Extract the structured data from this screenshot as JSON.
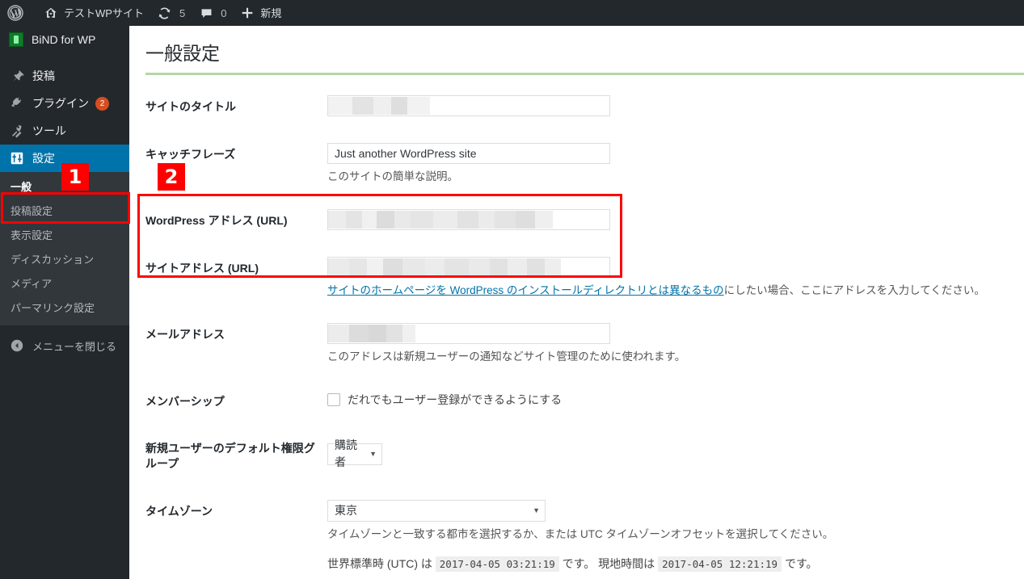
{
  "adminbar": {
    "logo_icon": "wordpress-logo-icon",
    "site_name": "テストWPサイト",
    "site_icon": "home-icon",
    "updates_icon": "updates-icon",
    "updates_count": "5",
    "comments_icon": "comment-bubble-icon",
    "comments_count": "0",
    "new_icon": "plus-icon",
    "new_label": "新規"
  },
  "sidebar": {
    "bind": {
      "label": "BiND for WP",
      "icon": "bind-app-icon"
    },
    "items": [
      {
        "label": "投稿",
        "icon": "pin-icon",
        "badge": ""
      },
      {
        "label": "プラグイン",
        "icon": "plug-icon",
        "badge": "2"
      },
      {
        "label": "ツール",
        "icon": "wrench-icon",
        "badge": ""
      },
      {
        "label": "設定",
        "icon": "sliders-icon",
        "badge": "",
        "current": true
      }
    ],
    "submenu": [
      {
        "label": "一般",
        "current": true
      },
      {
        "label": "投稿設定",
        "current": false
      },
      {
        "label": "表示設定",
        "current": false
      },
      {
        "label": "ディスカッション",
        "current": false
      },
      {
        "label": "メディア",
        "current": false
      },
      {
        "label": "パーマリンク設定",
        "current": false
      }
    ],
    "collapse": {
      "label": "メニューを閉じる",
      "icon": "collapse-arrow-icon"
    }
  },
  "main": {
    "page_title": "一般設定",
    "fields": {
      "site_title": {
        "label": "サイトのタイトル",
        "value": "",
        "redacted": true
      },
      "tagline": {
        "label": "キャッチフレーズ",
        "value": "Just another WordPress site",
        "desc": "このサイトの簡単な説明。"
      },
      "wp_address": {
        "label": "WordPress アドレス (URL)",
        "value": "",
        "redacted": true
      },
      "site_address": {
        "label": "サイトアドレス (URL)",
        "value": "",
        "redacted": true,
        "desc_link": "サイトのホームページを WordPress のインストールディレクトリとは異なるもの",
        "desc_tail": "にしたい場合、ここにアドレスを入力してください。"
      },
      "email": {
        "label": "メールアドレス",
        "value": "",
        "redacted": true,
        "desc": "このアドレスは新規ユーザーの通知などサイト管理のために使われます。"
      },
      "membership": {
        "label": "メンバーシップ",
        "checkbox_label": "だれでもユーザー登録ができるようにする",
        "checked": false
      },
      "default_role": {
        "label": "新規ユーザーのデフォルト権限グループ",
        "value": "購読者"
      },
      "timezone": {
        "label": "タイムゾーン",
        "value": "東京",
        "desc": "タイムゾーンと一致する都市を選択するか、または UTC タイムゾーンオフセットを選択してください。",
        "utc_prefix": "世界標準時 (UTC) は",
        "utc_time": "2017-04-05 03:21:19",
        "utc_suffix": "です。",
        "local_prefix": "現地時間は",
        "local_time": "2017-04-05 12:21:19",
        "local_suffix": "です。"
      }
    }
  },
  "annotations": {
    "marker_1": "1",
    "marker_2": "2",
    "color": "#ff0000"
  }
}
